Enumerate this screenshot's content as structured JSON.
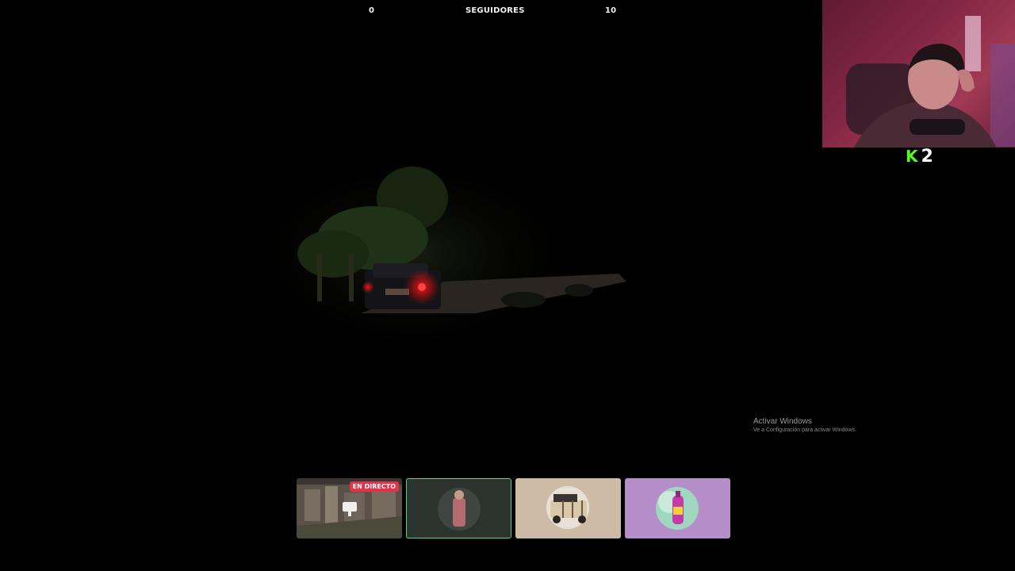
{
  "follower_goal": {
    "current": "0",
    "label": "SEGUIDORES",
    "goal": "10"
  },
  "webcam": {
    "badge_k": "K",
    "badge_number": "2"
  },
  "watermark": {
    "title": "Activar Windows",
    "subtitle": "Ve a Configuración para activar Windows."
  },
  "thumbnails": {
    "live_badge": "EN DIRECTO",
    "items": [
      {
        "id": "city-stream"
      },
      {
        "id": "character-portrait"
      },
      {
        "id": "vehicle-portrait"
      },
      {
        "id": "bottle-portrait"
      }
    ]
  },
  "colors": {
    "kick_green": "#53fc18",
    "live_red": "#e2334a",
    "selected_border": "#57d67a",
    "thumb_purple": "#b48dc9",
    "thumb_beige": "#cdbba5"
  }
}
